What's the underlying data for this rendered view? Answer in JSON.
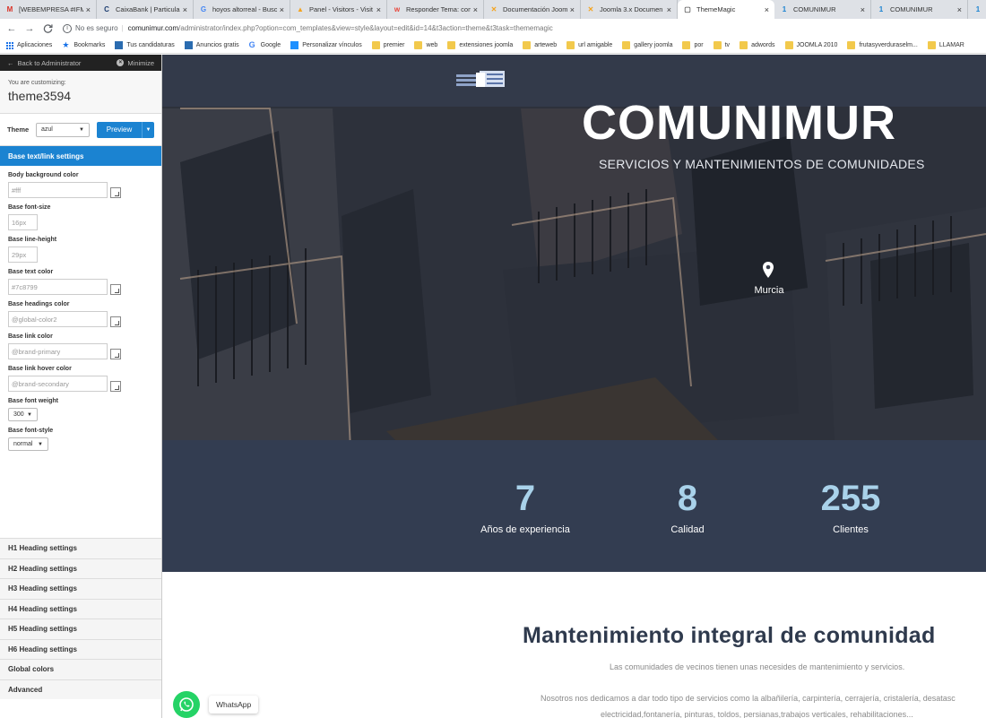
{
  "browser": {
    "tabs": [
      {
        "label": "[WEBEMPRESA #IFM",
        "favicon": "M",
        "color": "#d93025"
      },
      {
        "label": "CaixaBank | Particular",
        "favicon": "C",
        "color": "#1b3b6f"
      },
      {
        "label": "hoyos altorreal - Busc",
        "favicon": "G",
        "color": "#4285f4"
      },
      {
        "label": "Panel - Visitors - Visit",
        "favicon": "▲",
        "color": "#f4a31d"
      },
      {
        "label": "Responder Tema: com",
        "favicon": "w",
        "color": "#e8463b"
      },
      {
        "label": "Documentación Joom",
        "favicon": "✕",
        "color": "#f4a31d"
      },
      {
        "label": "Joomla 3.x Documen",
        "favicon": "✕",
        "color": "#f4a31d"
      },
      {
        "label": "ThemeMagic",
        "favicon": "▢",
        "color": "#555555",
        "active": true
      },
      {
        "label": "COMUNIMUR",
        "favicon": "1",
        "color": "#1b83d1"
      },
      {
        "label": "COMUNIMUR",
        "favicon": "1",
        "color": "#1b83d1"
      },
      {
        "label": "1",
        "favicon": "1",
        "color": "#1b83d1"
      }
    ],
    "tab_close": "×",
    "nav": {
      "back": "←",
      "forward": "→",
      "reload": "C"
    },
    "security_label": "No es seguro",
    "url_host": "comunimur.com",
    "url_path": "/administrator/index.php?option=com_templates&view=style&layout=edit&id=14&t3action=theme&t3task=thememagic",
    "bookmarks": [
      {
        "label": "Aplicaciones",
        "icon": "apps-icon"
      },
      {
        "label": "Bookmarks",
        "icon": "star-icon"
      },
      {
        "label": "Tus candidaturas",
        "icon": "blue-square-icon"
      },
      {
        "label": "Anuncios gratis",
        "icon": "blue-square-icon"
      },
      {
        "label": "Google",
        "icon": "google-icon"
      },
      {
        "label": "Personalizar vínculos",
        "icon": "windows-icon"
      },
      {
        "label": "premier",
        "icon": "folder-icon"
      },
      {
        "label": "web",
        "icon": "folder-icon"
      },
      {
        "label": "extensiones joomla",
        "icon": "folder-icon"
      },
      {
        "label": "arteweb",
        "icon": "folder-icon"
      },
      {
        "label": "url amigable",
        "icon": "folder-icon"
      },
      {
        "label": "gallery joomla",
        "icon": "folder-icon"
      },
      {
        "label": "por",
        "icon": "folder-icon"
      },
      {
        "label": "tv",
        "icon": "folder-icon"
      },
      {
        "label": "adwords",
        "icon": "folder-icon"
      },
      {
        "label": "JOOMLA 2010",
        "icon": "folder-icon"
      },
      {
        "label": "frutasyverduraselm...",
        "icon": "folder-icon"
      },
      {
        "label": "LLAMAR",
        "icon": "folder-icon"
      }
    ]
  },
  "panel": {
    "back_label": "Back to Administrator",
    "minimize_label": "Minimize",
    "customizing_label": "You are customizing:",
    "template_name": "theme3594",
    "theme_label": "Theme",
    "theme_value": "azul",
    "preview_label": "Preview",
    "section_title": "Base text/link settings",
    "fields": [
      {
        "label": "Body background color",
        "placeholder": "#fff",
        "type": "color"
      },
      {
        "label": "Base font-size",
        "placeholder": "16px",
        "type": "short"
      },
      {
        "label": "Base line-height",
        "placeholder": "29px",
        "type": "short"
      },
      {
        "label": "Base text color",
        "placeholder": "#7c8799",
        "type": "color"
      },
      {
        "label": "Base headings color",
        "placeholder": "@global-color2",
        "type": "color"
      },
      {
        "label": "Base link color",
        "placeholder": "@brand-primary",
        "type": "color"
      },
      {
        "label": "Base link hover color",
        "placeholder": "@brand-secondary",
        "type": "color"
      }
    ],
    "font_weight_label": "Base font weight",
    "font_weight_value": "300",
    "font_style_label": "Base font-style",
    "font_style_value": "normal",
    "accordion": [
      "H1 Heading settings",
      "H2 Heading settings",
      "H3 Heading settings",
      "H4 Heading settings",
      "H5 Heading settings",
      "H6 Heading settings",
      "Global colors",
      "Advanced"
    ]
  },
  "site": {
    "hero_title": "COMUNIMUR",
    "hero_subtitle": "SERVICIOS Y MANTENIMIENTOS DE COMUNIDADES",
    "location": "Murcia",
    "stats": [
      {
        "value": "7",
        "caption": "Años de experiencia"
      },
      {
        "value": "8",
        "caption": "Calidad"
      },
      {
        "value": "255",
        "caption": "Clientes"
      }
    ],
    "section_heading": "Mantenimiento integral de comunidad",
    "intro": "Las comunidades de vecinos tienen unas necesides de mantenimiento y servicios.",
    "body_line1": "Nosotros nos dedicamos a dar todo tipo de servicios como la albañilería, carpintería, cerrajería, cristalería, desatasc",
    "body_line2": "electricidad,fontanería, pinturas, toldos, persianas,trabajos verticales, rehabilitaciones...",
    "whatsapp_label": "WhatsApp"
  },
  "colors": {
    "accent": "#1b83d1",
    "navbar": "#333a4a",
    "stats_bg": "#333d51",
    "stat_number": "#a9d2ea",
    "heading": "#2f3a4d",
    "whatsapp": "#25d366"
  }
}
